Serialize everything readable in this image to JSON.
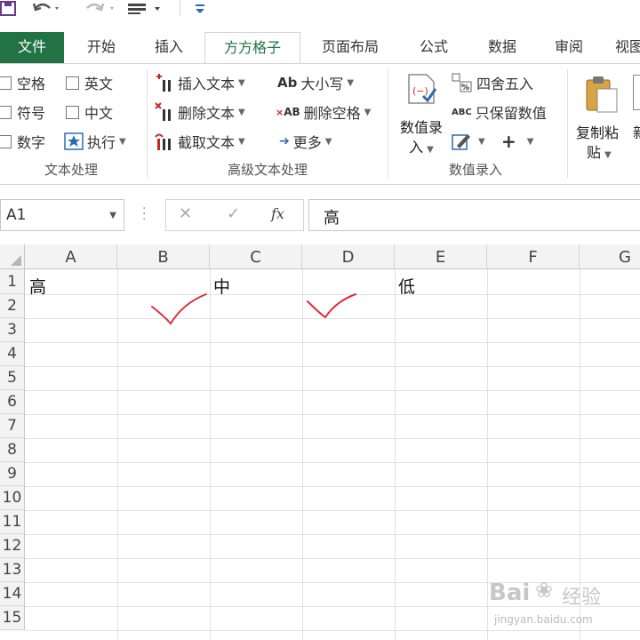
{
  "tabs": {
    "file": "文件",
    "home": "开始",
    "insert": "插入",
    "ffgz": "方方格子",
    "page_layout": "页面布局",
    "formulas": "公式",
    "data": "数据",
    "review": "审阅",
    "view": "视图"
  },
  "ribbon": {
    "text_group": {
      "label": "文本处理",
      "items": [
        "空格",
        "英文",
        "符号",
        "中文",
        "数字",
        "执行"
      ]
    },
    "adv_text_group": {
      "label": "高级文本处理",
      "insert_text": "插入文本",
      "delete_text": "删除文本",
      "extract_text": "截取文本",
      "case": "大小写",
      "delete_spaces": "删除空格",
      "more": "更多"
    },
    "number_group": {
      "label": "数值录入",
      "entry_line1": "数值录",
      "entry_line2": "入",
      "round": "四舍五入",
      "keep_values": "只保留数值",
      "plus": "+"
    },
    "clipboard": {
      "copy_paste_line1": "复制粘",
      "copy_paste_line2": "贴",
      "partial": "新"
    }
  },
  "formula_bar": {
    "name_box": "A1",
    "cancel": "✕",
    "enter": "✓",
    "fx": "fx",
    "content": "高"
  },
  "grid": {
    "columns": [
      "A",
      "B",
      "C",
      "D",
      "E",
      "F",
      "G"
    ],
    "rows": [
      "1",
      "2",
      "3",
      "4",
      "5",
      "6",
      "7",
      "8",
      "9",
      "10",
      "11",
      "12",
      "13",
      "14",
      "15"
    ],
    "cells": {
      "A1": "高",
      "C1": "中",
      "E1": "低"
    }
  },
  "watermark": {
    "brand": "Bai",
    "brand2": "经验",
    "url": "jingyan.baidu.com"
  },
  "colors": {
    "excel_green": "#217346",
    "check_red": "#d9303a"
  }
}
